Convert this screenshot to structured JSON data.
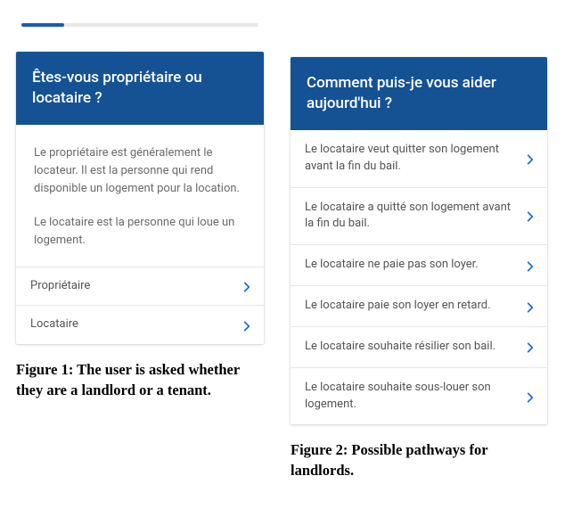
{
  "colors": {
    "header_bg": "#155294",
    "chevron": "#1a6fe0",
    "progress_bg": "#e8e8e8",
    "progress_fill": "#1a57c4"
  },
  "progress": {
    "percent": 18
  },
  "figure1": {
    "header": "Êtes-vous propriétaire ou locataire ?",
    "body_p1": "Le propriétaire est généralement le locateur. Il est la personne qui rend disponible un logement pour la location.",
    "body_p2": "Le locataire est la personne qui loue un logement.",
    "options": [
      {
        "label": "Propriétaire"
      },
      {
        "label": "Locataire"
      }
    ],
    "caption": "Figure 1: The user is asked whether they are a landlord or a tenant."
  },
  "figure2": {
    "header": "Comment puis-je vous aider aujourd'hui ?",
    "items": [
      {
        "label": "Le locataire veut quitter son logement avant la fin du bail."
      },
      {
        "label": "Le locataire a quitté son logement avant la fin du bail."
      },
      {
        "label": "Le locataire ne paie pas son loyer."
      },
      {
        "label": "Le locataire paie son loyer en retard."
      },
      {
        "label": "Le locataire souhaite résilier son bail."
      },
      {
        "label": "Le locataire souhaite sous-louer son logement."
      }
    ],
    "caption": "Figure 2: Possible pathways for landlords."
  }
}
